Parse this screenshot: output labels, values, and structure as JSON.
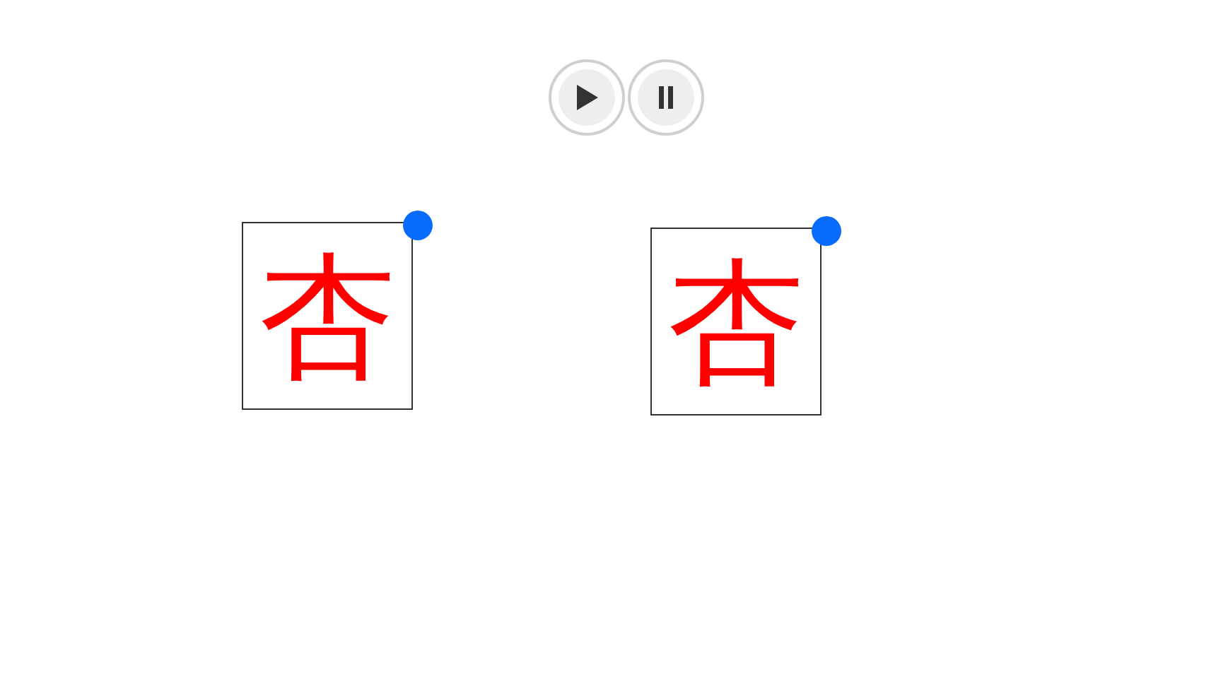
{
  "controls": [
    {
      "kind": "play"
    },
    {
      "kind": "pause"
    }
  ],
  "cards": [
    {
      "character": "杏"
    },
    {
      "character": "杏"
    }
  ]
}
